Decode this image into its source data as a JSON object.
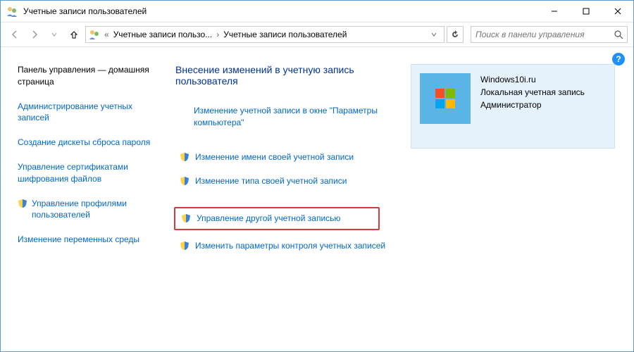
{
  "window": {
    "title": "Учетные записи пользователей"
  },
  "nav": {
    "crumb1": "Учетные записи пользо...",
    "crumb2": "Учетные записи пользователей",
    "search_placeholder": "Поиск в панели управления"
  },
  "sidebar": {
    "home": "Панель управления — домашняя страница",
    "links": [
      "Администрирование учетных записей",
      "Создание дискеты сброса пароля",
      "Управление сертификатами шифрования файлов",
      "Управление профилями пользователей",
      "Изменение переменных среды"
    ]
  },
  "main": {
    "heading": "Внесение изменений в учетную запись пользователя",
    "link_pcsettings": "Изменение учетной записи в окне \"Параметры компьютера\"",
    "link_rename": "Изменение имени своей учетной записи",
    "link_type": "Изменение типа своей учетной записи",
    "link_manage_other": "Управление другой учетной записью",
    "link_uac": "Изменить параметры контроля учетных записей"
  },
  "user": {
    "name": "Windows10i.ru",
    "type": "Локальная учетная запись",
    "role": "Администратор"
  },
  "help": "?"
}
